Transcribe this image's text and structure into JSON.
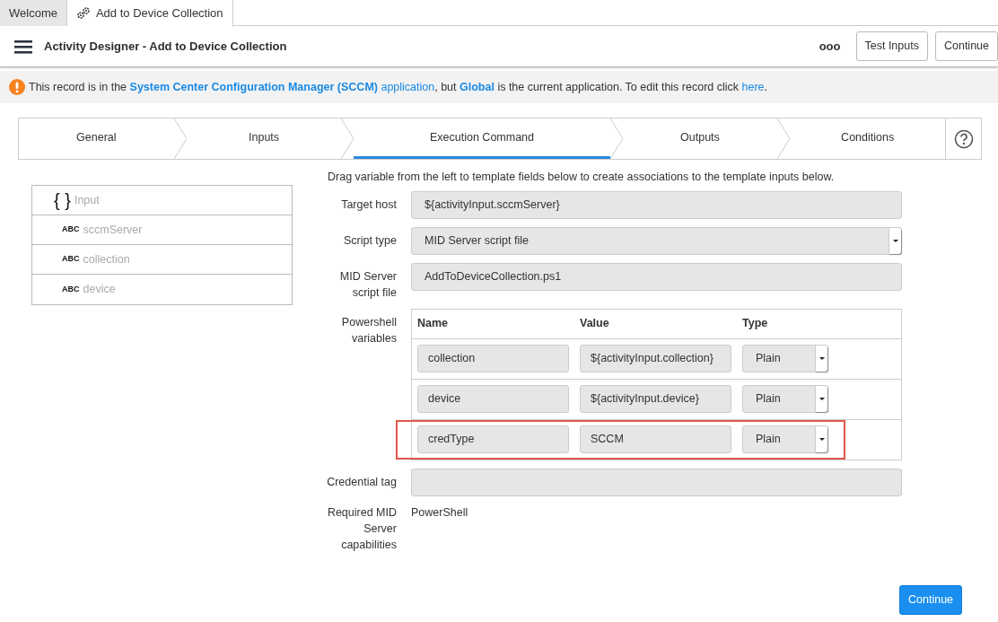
{
  "tabs": [
    {
      "label": "Welcome",
      "selected": false,
      "icon": false
    },
    {
      "label": "Add to Device Collection",
      "selected": true,
      "icon": true
    }
  ],
  "header": {
    "title": "Activity Designer - Add to Device Collection",
    "more": "ooo",
    "buttons": [
      "Test Inputs",
      "Continue"
    ]
  },
  "notice": {
    "segments": [
      {
        "kind": "text",
        "text": "This record is in the "
      },
      {
        "kind": "link",
        "text": "**System Center Configuration Manager (SCCM)** application"
      },
      {
        "kind": "text",
        "text": ", but "
      },
      {
        "kind": "link",
        "text": "**Global**"
      },
      {
        "kind": "text",
        "text": " is the current application. To edit this record click "
      },
      {
        "kind": "link",
        "text": "here"
      },
      {
        "kind": "text",
        "text": "."
      }
    ]
  },
  "steps": [
    {
      "label": "General",
      "selected": false
    },
    {
      "label": "Inputs",
      "selected": false
    },
    {
      "label": "Execution Command",
      "selected": true
    },
    {
      "label": "Outputs",
      "selected": false
    },
    {
      "label": "Conditions",
      "selected": false
    }
  ],
  "variables": [
    {
      "badge": "{ }",
      "label": "Input",
      "children": [
        {
          "badge": "ABC",
          "label": "sccmServer"
        },
        {
          "badge": "ABC",
          "label": "collection"
        },
        {
          "badge": "ABC",
          "label": "device"
        }
      ]
    }
  ],
  "instructions": "Drag variable from the left to template fields below to create associations to the template inputs below.",
  "form": [
    {
      "kind": "text",
      "label": "Target host",
      "value": "${activityInput.sccmServer}"
    },
    {
      "kind": "select",
      "label": "Script type",
      "value": "MID Server script file"
    },
    {
      "kind": "text",
      "label": "MID Server script file",
      "value": "AddToDeviceCollection.ps1"
    },
    {
      "kind": "table",
      "label": "Powershell variables",
      "columns": [
        "Name",
        "Value",
        "Type"
      ],
      "rows": [
        {
          "name": "collection",
          "value": "${activityInput.collection}",
          "type": "Plain",
          "highlighted": false
        },
        {
          "name": "device",
          "value": "${activityInput.device}",
          "type": "Plain",
          "highlighted": false
        },
        {
          "name": "credType",
          "value": "SCCM",
          "type": "Plain",
          "highlighted": true
        }
      ]
    },
    {
      "kind": "text",
      "label": "Credential tag"
    },
    {
      "kind": "static",
      "label": "Required MID Server capabilities",
      "value": "PowerShell"
    }
  ],
  "footer_button": "Continue"
}
